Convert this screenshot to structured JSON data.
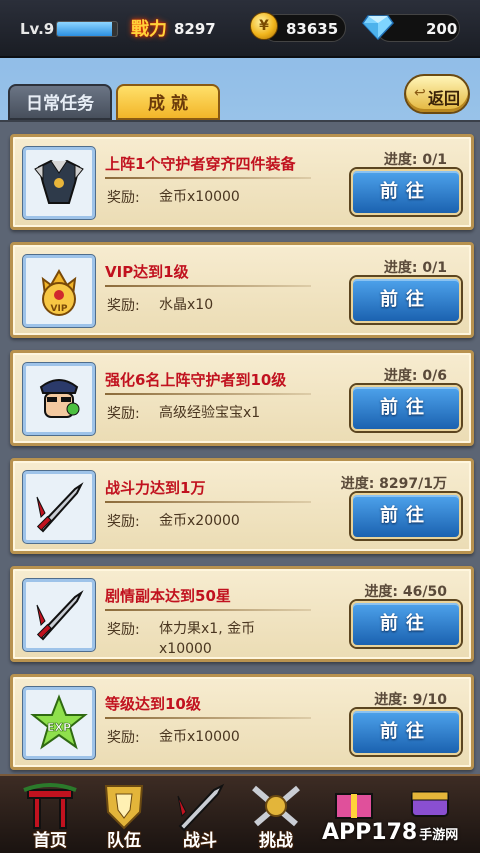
{
  "status_bar": {
    "level": "Lv.9",
    "level_progress": 0.92,
    "power_icon_text": "戰力",
    "power": "8297",
    "gold": "83635",
    "gems": "200"
  },
  "tabs": [
    {
      "label": "日常任务",
      "active": false
    },
    {
      "label": "成 就",
      "active": true
    }
  ],
  "back_button": {
    "label": "返回"
  },
  "tasks": [
    {
      "title": "上阵1个守护者穿齐四件装备",
      "reward_label": "奖励:",
      "reward": "金币x10000",
      "progress": "进度: 0/1",
      "button": "前往",
      "icon": "armor-icon"
    },
    {
      "title": "VIP达到1级",
      "reward_label": "奖励:",
      "reward": "水晶x10",
      "progress": "进度: 0/1",
      "button": "前往",
      "icon": "vip-badge-icon"
    },
    {
      "title": "强化6名上阵守护者到10级",
      "reward_label": "奖励:",
      "reward": "高级经验宝宝x1",
      "progress": "进度: 0/6",
      "button": "前往",
      "icon": "hero-portrait-icon"
    },
    {
      "title": "战斗力达到1万",
      "reward_label": "奖励:",
      "reward": "金币x20000",
      "progress": "进度: 8297/1万",
      "button": "前往",
      "icon": "sword-icon"
    },
    {
      "title": "剧情副本达到50星",
      "reward_label": "奖励:",
      "reward": "体力果x1, 金币x10000",
      "progress": "进度: 46/50",
      "button": "前往",
      "icon": "sword-icon"
    },
    {
      "title": "等级达到10级",
      "reward_label": "奖励:",
      "reward": "金币x10000",
      "progress": "进度: 9/10",
      "button": "前往",
      "icon": "exp-star-icon"
    }
  ],
  "bottom_nav": [
    {
      "label": "首页",
      "icon": "home-gate-icon"
    },
    {
      "label": "队伍",
      "icon": "team-shield-icon"
    },
    {
      "label": "战斗",
      "icon": "battle-sword-icon"
    },
    {
      "label": "挑战",
      "icon": "challenge-crossed-swords-icon"
    }
  ],
  "watermark": {
    "main": "APP178",
    "sub": "手游网"
  },
  "colors": {
    "title_red": "#c1121f",
    "button_blue": "#1b62b0",
    "card_bg": "#f7ecd0",
    "gold_accent": "#f2b529"
  }
}
